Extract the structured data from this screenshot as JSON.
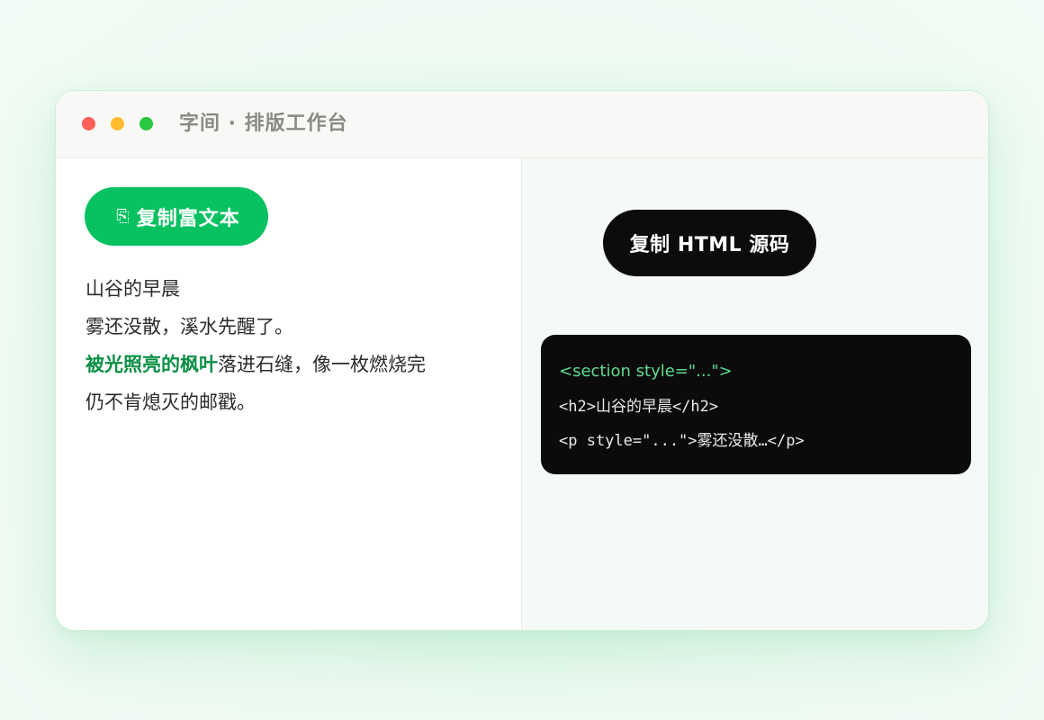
{
  "window": {
    "title": "字间 · 排版工作台",
    "traffic_lights": {
      "close_color": "#ff5f57",
      "minimize_color": "#febc2e",
      "maximize_color": "#28c840"
    }
  },
  "editor": {
    "copy_rich_text_button": {
      "icon": "clipboard-icon",
      "icon_glyph": "⎘",
      "label": "复制富文本",
      "color": "#08c160"
    },
    "article": {
      "title": "山谷的早晨",
      "line1": "雾还没散，溪水先醒了。",
      "highlight": "被光照亮的枫叶",
      "line2_rest": "落进石缝，像一枚燃烧完",
      "line3": "仍不肯熄灭的邮戳。",
      "highlight_color": "#0b8f45"
    }
  },
  "preview": {
    "copy_html_button": {
      "label": "复制 HTML 源码",
      "color": "#0c0c0c"
    },
    "code": {
      "line1": "<section style=\"...\">",
      "line2": "<h2>山谷的早晨</h2>",
      "line3": "<p style=\"...\">雾还没散…</p>",
      "tag_color": "#5fdc8f"
    }
  }
}
